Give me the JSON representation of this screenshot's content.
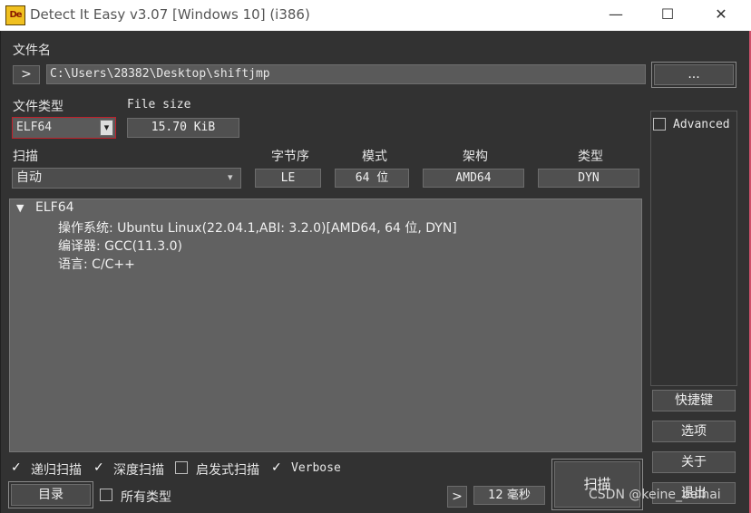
{
  "window": {
    "title": "Detect It Easy v3.07 [Windows 10] (i386)",
    "logo": "De",
    "minimize": "—",
    "maximize": "☐",
    "close": "✕"
  },
  "file": {
    "label": "文件名",
    "nav_glyph": ">",
    "path": "C:\\Users\\28382\\Desktop\\shiftjmp",
    "browse": "..."
  },
  "file_type": {
    "label": "文件类型",
    "value": "ELF64",
    "arrow": "▾"
  },
  "file_size": {
    "label": "File size",
    "value": "15.70 KiB"
  },
  "advanced": {
    "label": "Advanced",
    "checked": false
  },
  "scan_mode": {
    "label": "扫描",
    "value": "自动",
    "arrow": "▾"
  },
  "info": {
    "endian": {
      "label": "字节序",
      "value": "LE"
    },
    "mode": {
      "label": "模式",
      "value": "64 位"
    },
    "arch": {
      "label": "架构",
      "value": "AMD64"
    },
    "type": {
      "label": "类型",
      "value": "DYN"
    }
  },
  "results": {
    "root": "ELF64",
    "expander": "▼",
    "items": [
      "操作系统: Ubuntu Linux(22.04.1,ABI: 3.2.0)[AMD64, 64 位, DYN]",
      "编译器: GCC(11.3.0)",
      "语言: C/C++"
    ]
  },
  "options": {
    "recursive": {
      "label": "递归扫描",
      "checked": true
    },
    "deep": {
      "label": "深度扫描",
      "checked": true
    },
    "heuristic": {
      "label": "启发式扫描",
      "checked": false
    },
    "verbose": {
      "label": "Verbose",
      "checked": true
    },
    "all_types": {
      "label": "所有类型",
      "checked": false
    },
    "check_glyph": "✓"
  },
  "buttons": {
    "directory": "目录",
    "shortcuts": "快捷键",
    "options": "选项",
    "about": "关于",
    "exit": "退出",
    "scan": "扫描",
    "nav": ">"
  },
  "elapsed": "12 毫秒",
  "watermark": "CSDN @keine_beihai",
  "colors": {
    "background": "#323232",
    "panel": "#616161",
    "highlight_border": "#c0202a"
  }
}
